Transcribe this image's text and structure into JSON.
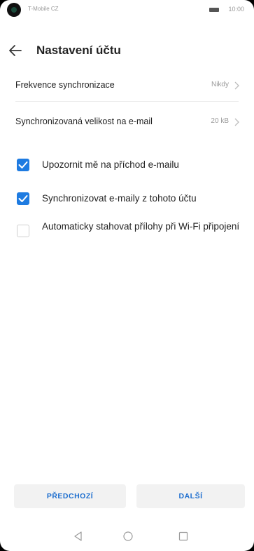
{
  "status_bar": {
    "carrier": "T-Mobile CZ",
    "time": "10:00"
  },
  "header": {
    "title": "Nastavení účtu"
  },
  "settings": [
    {
      "label": "Frekvence synchronizace",
      "value": "Nikdy"
    },
    {
      "label": "Synchronizovaná velikost na e-mail",
      "value": "20 kB"
    }
  ],
  "checkboxes": [
    {
      "label": "Upozornit mě na příchod e-mailu",
      "checked": true
    },
    {
      "label": "Synchronizovat e-maily z tohoto účtu",
      "checked": true
    },
    {
      "label": "Automaticky stahovat přílohy při Wi-Fi připojení",
      "checked": false
    }
  ],
  "buttons": {
    "previous": "PŘEDCHOZÍ",
    "next": "DALŠÍ"
  },
  "colors": {
    "accent": "#1e7be1",
    "button_text": "#1e6fcf",
    "button_bg": "#f2f2f2"
  },
  "icons": {
    "back": "arrow-left-icon",
    "chevron": "chevron-right-icon",
    "nav_back": "triangle-back-icon",
    "nav_home": "circle-home-icon",
    "nav_recent": "square-recent-icon"
  }
}
